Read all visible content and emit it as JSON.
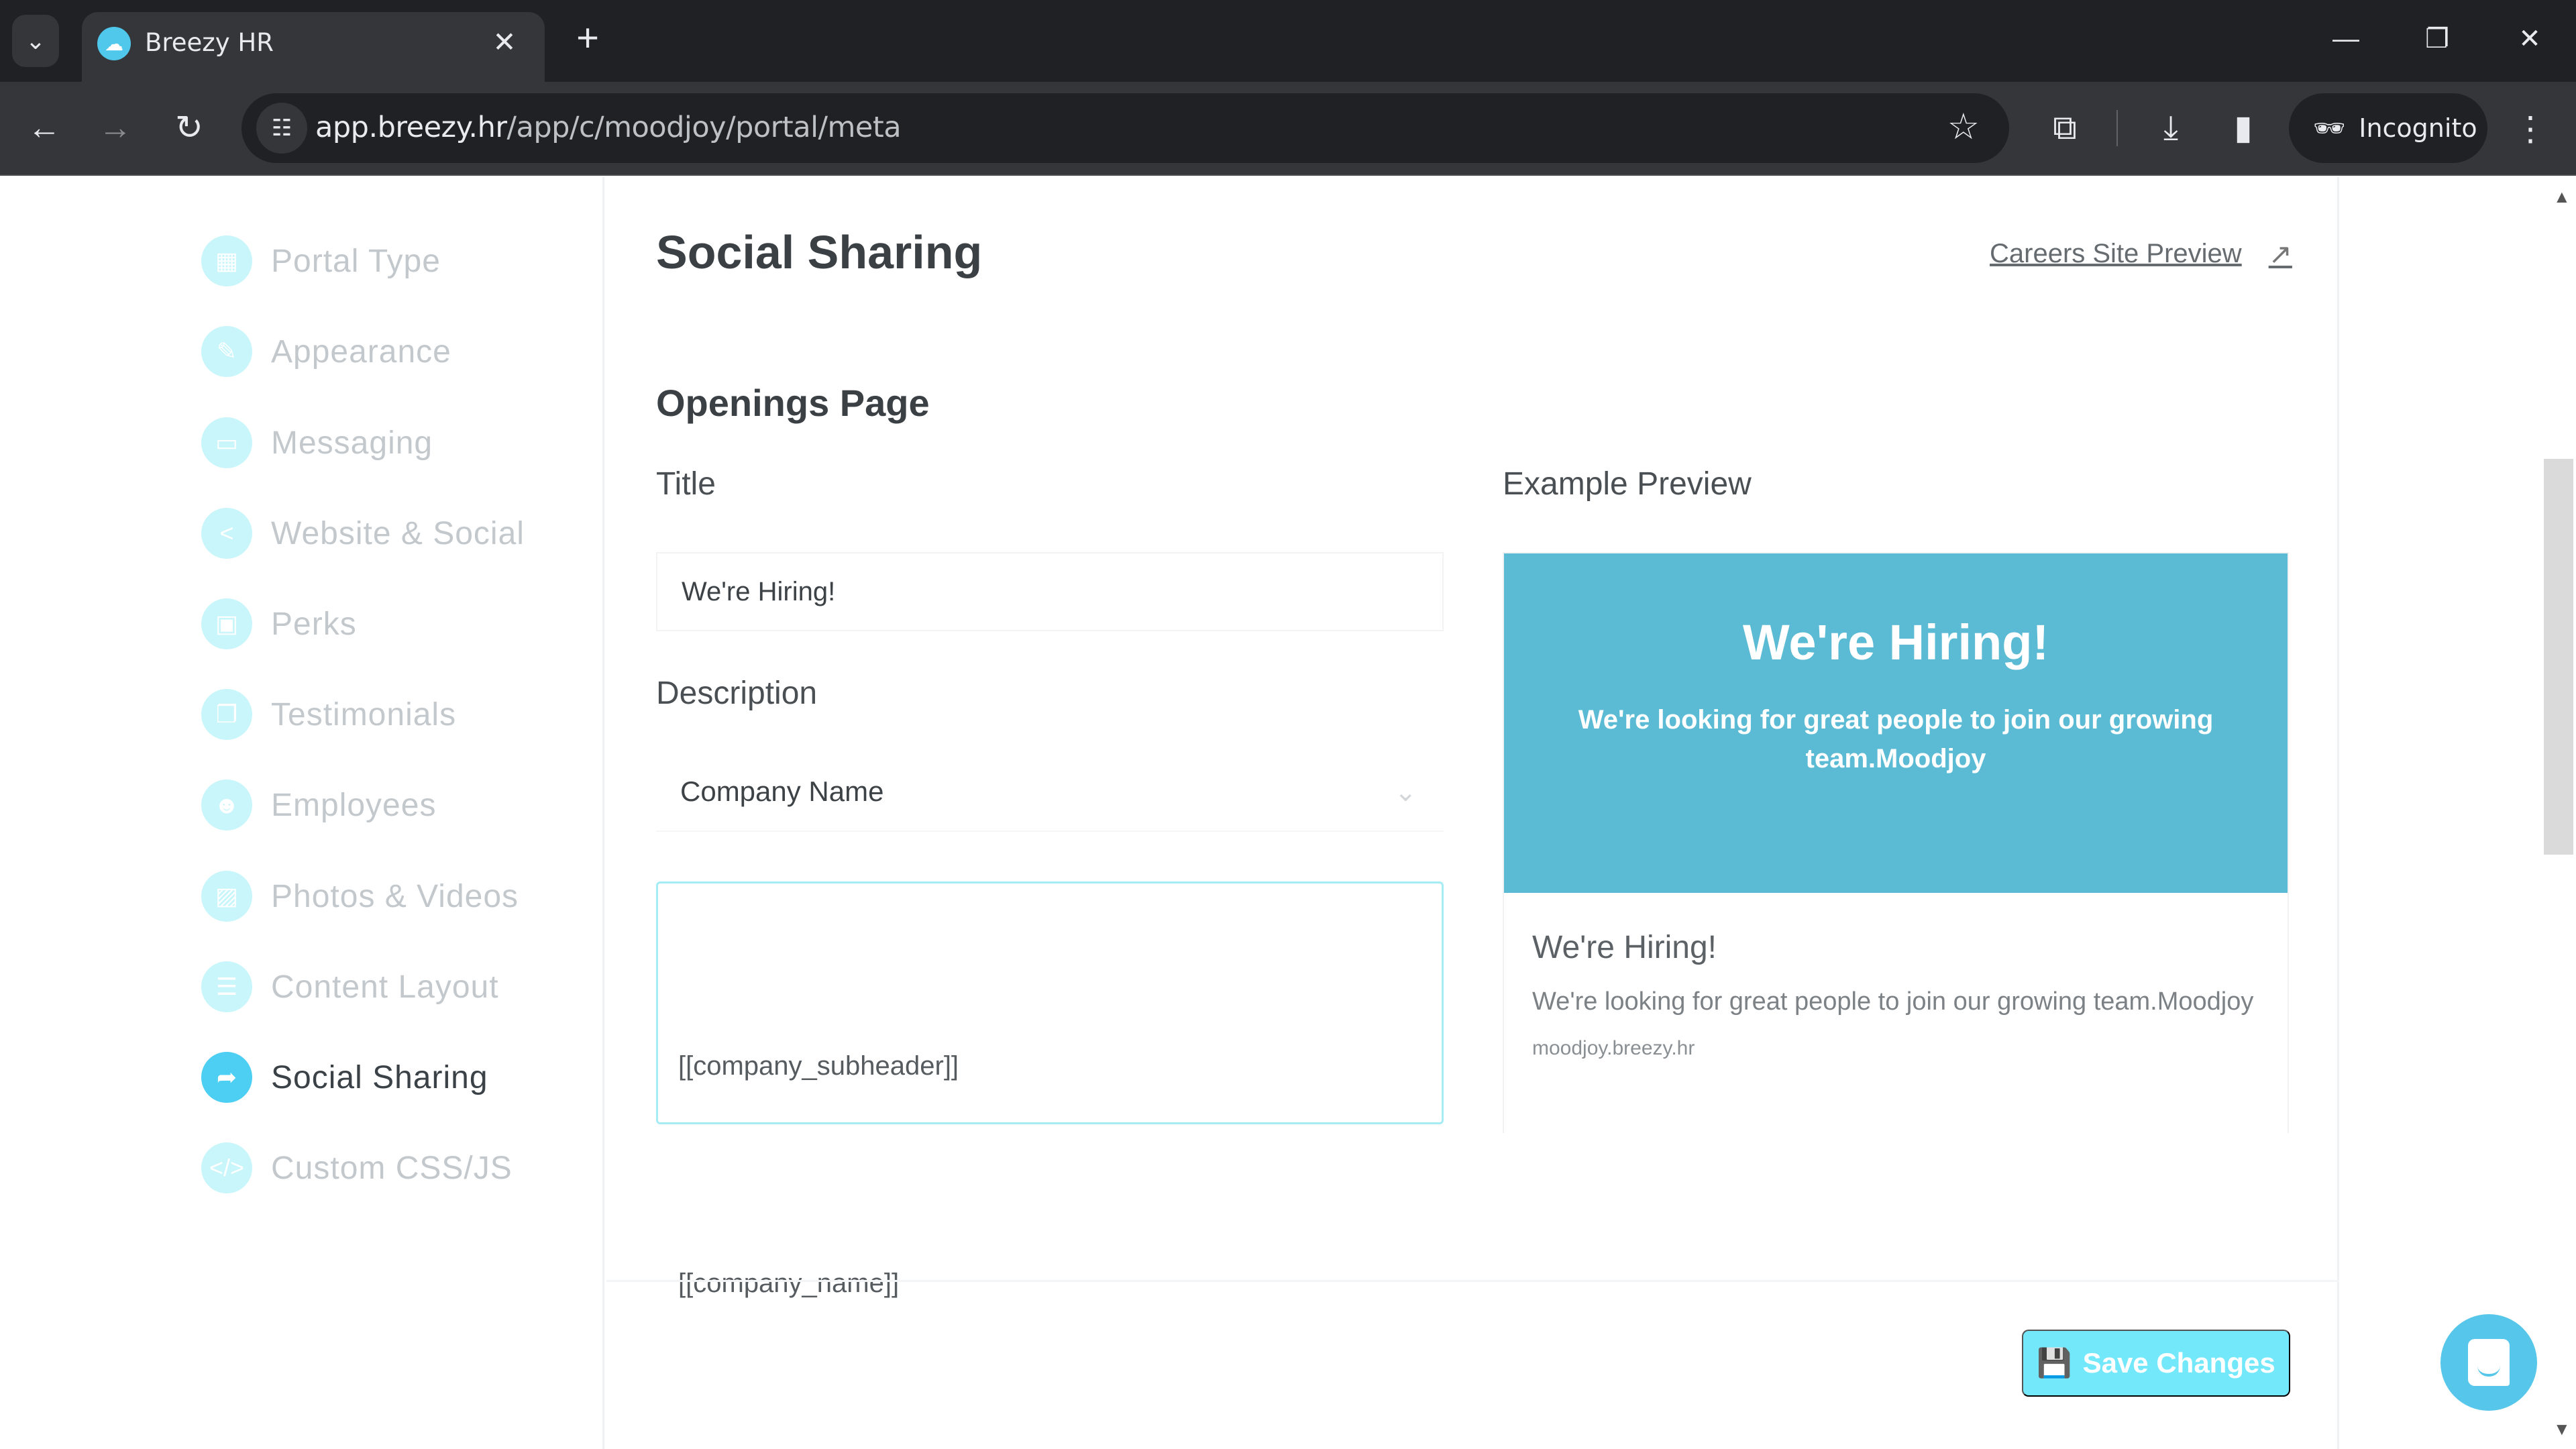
{
  "browser": {
    "tab_title": "Breezy HR",
    "url_host": "app.breezy.hr",
    "url_path": "/app/c/moodjoy/portal/meta",
    "incognito_label": "Incognito",
    "icons": {
      "tab_search": "chevron-down-icon",
      "favicon": "breezy-cloud-icon",
      "close_tab": "close-icon",
      "new_tab": "plus-icon",
      "back": "arrow-left-icon",
      "forward": "arrow-right-icon",
      "reload": "reload-icon",
      "site_info": "tune-icon",
      "bookmark": "star-icon",
      "extensions": "puzzle-icon",
      "downloads": "download-icon",
      "side_panel": "side-panel-icon",
      "incognito": "incognito-icon",
      "menu": "kebab-menu-icon",
      "minimize": "minimize-icon",
      "restore": "restore-icon",
      "close_window": "close-icon"
    }
  },
  "sidebar": {
    "items": [
      {
        "label": "Portal Type",
        "icon": "grid-icon",
        "active": false
      },
      {
        "label": "Appearance",
        "icon": "brush-icon",
        "active": false
      },
      {
        "label": "Messaging",
        "icon": "chat-bubble-icon",
        "active": false
      },
      {
        "label": "Website & Social",
        "icon": "share-icon",
        "active": false
      },
      {
        "label": "Perks",
        "icon": "gift-icon",
        "active": false
      },
      {
        "label": "Testimonials",
        "icon": "comments-icon",
        "active": false
      },
      {
        "label": "Employees",
        "icon": "people-icon",
        "active": false
      },
      {
        "label": "Photos & Videos",
        "icon": "image-icon",
        "active": false
      },
      {
        "label": "Content Layout",
        "icon": "list-icon",
        "active": false
      },
      {
        "label": "Social Sharing",
        "icon": "share-arrow-icon",
        "active": true
      },
      {
        "label": "Custom CSS/JS",
        "icon": "code-icon",
        "active": false
      }
    ]
  },
  "main": {
    "page_title": "Social Sharing",
    "preview_link": "Careers Site Preview",
    "section_title": "Openings Page",
    "title_label": "Title",
    "title_value": "We're Hiring!",
    "description_label": "Description",
    "description_select": "Company Name",
    "description_lines": [
      "[[company_subheader]]",
      "[[company_name]]"
    ],
    "example_label": "Example Preview",
    "preview": {
      "hero_title": "We're Hiring!",
      "hero_desc": "We're looking for great people to join our growing team.Moodjoy",
      "card_title": "We're Hiring!",
      "card_desc": "We're looking for great people to join our growing team.Moodjoy",
      "card_url": "moodjoy.breezy.hr"
    },
    "save_label": "Save Changes"
  },
  "colors": {
    "accent": "#4ccff2",
    "preview_hero": "#5bbbd4",
    "save_button": "#74e8fb"
  }
}
